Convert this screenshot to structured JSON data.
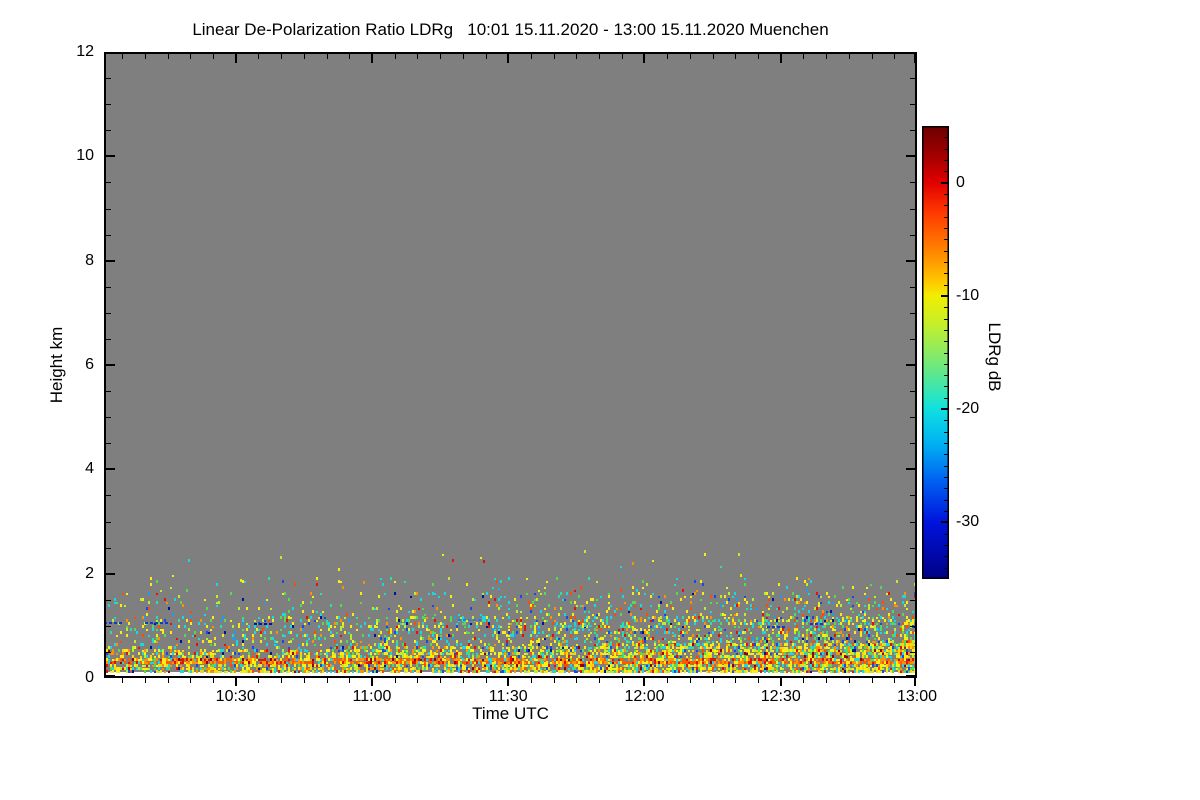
{
  "figure": {
    "title": "Linear De-Polarization Ratio LDRg   10:01 15.11.2020 - 13:00 15.11.2020 Muenchen",
    "x_axis": {
      "label": "Time UTC",
      "start": "10:01",
      "end": "13:00",
      "duration_min": 179,
      "ticks": [
        {
          "label": "10:30",
          "min": 29
        },
        {
          "label": "11:00",
          "min": 59
        },
        {
          "label": "11:30",
          "min": 89
        },
        {
          "label": "12:00",
          "min": 119
        },
        {
          "label": "12:30",
          "min": 149
        },
        {
          "label": "13:00",
          "min": 179
        }
      ],
      "minor_step_min": 5
    },
    "y_axis": {
      "label": "Height km",
      "range_km": [
        0,
        12
      ],
      "ticks": [
        0,
        2,
        4,
        6,
        8,
        10,
        12
      ],
      "minor_step_km": 0.5
    },
    "colorbar": {
      "label": "LDRg dB",
      "range_db": [
        -35,
        5
      ],
      "ticks": [
        {
          "label": "0",
          "value": 0
        },
        {
          "label": "-10",
          "value": -10
        },
        {
          "label": "-20",
          "value": -20
        },
        {
          "label": "-30",
          "value": -30
        }
      ],
      "minor_step_db": 1
    }
  },
  "chart_data": {
    "type": "heatmap",
    "title": "Linear De-Polarization Ratio LDRg   10:01 15.11.2020 - 13:00 15.11.2020 Muenchen",
    "xlabel": "Time UTC",
    "ylabel": "Height km",
    "x_range": [
      "10:01",
      "13:00"
    ],
    "y_range_km": [
      0,
      12
    ],
    "colorbar_label": "LDRg dB",
    "colorbar_range_db": [
      -35,
      5
    ],
    "colorbar_ticks": [
      0,
      -10,
      -20,
      -30
    ],
    "legend_position": "right-colorbar",
    "grid": false,
    "background_meaning": "uniform gray = masked / no depolarization signal above ~2 km",
    "observed_pattern": "Speckled LDRg echoes confined below ~1.8 km; dense yellow-green band below ~0.6 km with a continuous orange-red streak near 0.3-0.38 km; speckle density and depth increase from 10:01 toward 13:00; occasional dark-blue horizontal dash artifacts near 1 km; isolated dots up to ~2.3 km around 11:25",
    "colormap_stops_top_to_bottom": [
      [
        0.0,
        "#6b0000"
      ],
      [
        0.06,
        "#9e0000"
      ],
      [
        0.125,
        "#e10000"
      ],
      [
        0.19,
        "#ff3800"
      ],
      [
        0.27,
        "#ff7f00"
      ],
      [
        0.34,
        "#ffc400"
      ],
      [
        0.375,
        "#f2ee00"
      ],
      [
        0.44,
        "#c3ef2d"
      ],
      [
        0.53,
        "#6fe87e"
      ],
      [
        0.6,
        "#27e5c4"
      ],
      [
        0.625,
        "#10dfe0"
      ],
      [
        0.7,
        "#00b2f2"
      ],
      [
        0.78,
        "#0064f2"
      ],
      [
        0.875,
        "#0013dc"
      ],
      [
        1.0,
        "#000083"
      ]
    ],
    "render": {
      "seed": 1234567,
      "gray": "#7f7f7f",
      "cell": {
        "w": 2,
        "h": 3
      },
      "data_bottom_km": 0.13,
      "data_top_km": 2.45,
      "density": {
        "below_streak": {
          "p0": 0.6,
          "p1": 0.85
        },
        "streak": {
          "h0": 0.29,
          "h1": 0.38,
          "p": 0.9
        },
        "surface": {
          "h_top0": 0.55,
          "h_top1": 0.72,
          "p0": 0.45,
          "p1": 0.8
        },
        "mid": {
          "h_top": 1.2,
          "p0": 0.14,
          "p1": 0.48
        },
        "high": {
          "h_top": 1.65,
          "p0": 0.04,
          "p1": 0.2
        },
        "vhigh": {
          "h_top": 1.95,
          "p0": 0.012,
          "p1": 0.05
        },
        "trace": {
          "h_top": 2.45,
          "p": 0.004
        }
      },
      "palettes": {
        "dense": [
          [
            "#f8ef10",
            30
          ],
          [
            "#ffd400",
            10
          ],
          [
            "#b8ee2c",
            12
          ],
          [
            "#52dc52",
            8
          ],
          [
            "#19d8e0",
            12
          ],
          [
            "#28e0a8",
            3
          ],
          [
            "#ff9100",
            9
          ],
          [
            "#ff4a00",
            4
          ],
          [
            "#e81000",
            4
          ],
          [
            "#9b0000",
            2
          ],
          [
            "#1a49e8",
            4
          ],
          [
            "#001498",
            2
          ]
        ],
        "streak": [
          [
            "#ff9100",
            28
          ],
          [
            "#ff5a00",
            20
          ],
          [
            "#e81000",
            14
          ],
          [
            "#f8ef10",
            22
          ],
          [
            "#9b0000",
            5
          ],
          [
            "#52dc52",
            5
          ],
          [
            "#19d8e0",
            6
          ]
        ],
        "upper": [
          [
            "#f8ef10",
            26
          ],
          [
            "#b8ee2c",
            12
          ],
          [
            "#52dc52",
            14
          ],
          [
            "#19d8e0",
            18
          ],
          [
            "#28e0a8",
            6
          ],
          [
            "#ff9100",
            7
          ],
          [
            "#ff4a00",
            4
          ],
          [
            "#e81000",
            4
          ],
          [
            "#1a49e8",
            5
          ],
          [
            "#1e9df0",
            4
          ],
          [
            "#001498",
            3
          ]
        ]
      },
      "dashes": [
        {
          "t0": 0,
          "t1": 4,
          "h": 1.08,
          "c": "#1238d0"
        },
        {
          "t0": 9,
          "t1": 14,
          "h": 1.08,
          "c": "#1238d0"
        },
        {
          "t0": 33,
          "t1": 36.5,
          "h": 1.06,
          "c": "#001498"
        },
        {
          "t0": 78,
          "t1": 83,
          "h": 1.13,
          "c": "#1e7ef0"
        },
        {
          "t0": 99,
          "t1": 107,
          "h": 1.02,
          "c": "#19c8e0"
        },
        {
          "t0": 146,
          "t1": 150,
          "h": 1.0,
          "c": "#1238d0"
        },
        {
          "t0": 155.5,
          "t1": 158,
          "h": 1.06,
          "c": "#1238d0"
        }
      ],
      "dots": [
        {
          "t": 83.5,
          "h": 2.26,
          "c": "#cc1800"
        },
        {
          "t": 86.8,
          "h": 1.72,
          "c": "#18aef0"
        },
        {
          "t": 30,
          "h": 1.9,
          "c": "#f0e800"
        },
        {
          "t": 140,
          "h": 2.0,
          "c": "#f0e800"
        },
        {
          "t": 57,
          "h": 1.85,
          "c": "#ff8c00"
        }
      ]
    }
  }
}
